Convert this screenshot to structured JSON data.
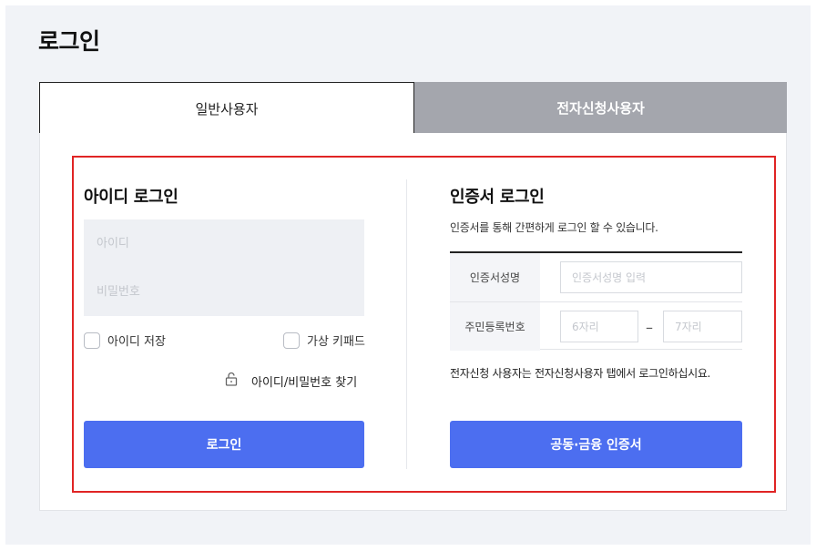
{
  "page": {
    "title": "로그인"
  },
  "tabs": [
    {
      "label": "일반사용자",
      "active": true
    },
    {
      "label": "전자신청사용자",
      "active": false
    }
  ],
  "id_login": {
    "title": "아이디 로그인",
    "id_placeholder": "아이디",
    "password_placeholder": "비밀번호",
    "save_id_label": "아이디 저장",
    "virtual_keypad_label": "가상 키패드",
    "find_link": "아이디/비밀번호 찾기",
    "find_icon": "lock-open-icon",
    "login_button": "로그인"
  },
  "cert_login": {
    "title": "인증서 로그인",
    "description": "인증서를 통해 간편하게 로그인 할 수 있습니다.",
    "name_label": "인증서성명",
    "name_placeholder": "인증서성명 입력",
    "rrn_label": "주민등록번호",
    "rrn_front_placeholder": "6자리",
    "rrn_separator": "–",
    "rrn_back_placeholder": "7자리",
    "note": "전자신청 사용자는 전자신청사용자 탭에서 로그인하십시요.",
    "cert_button": "공동·금융 인증서"
  },
  "colors": {
    "primary_button": "#4c6ef0",
    "inactive_tab": "#a4a6ad",
    "highlight_border": "#e02424"
  }
}
